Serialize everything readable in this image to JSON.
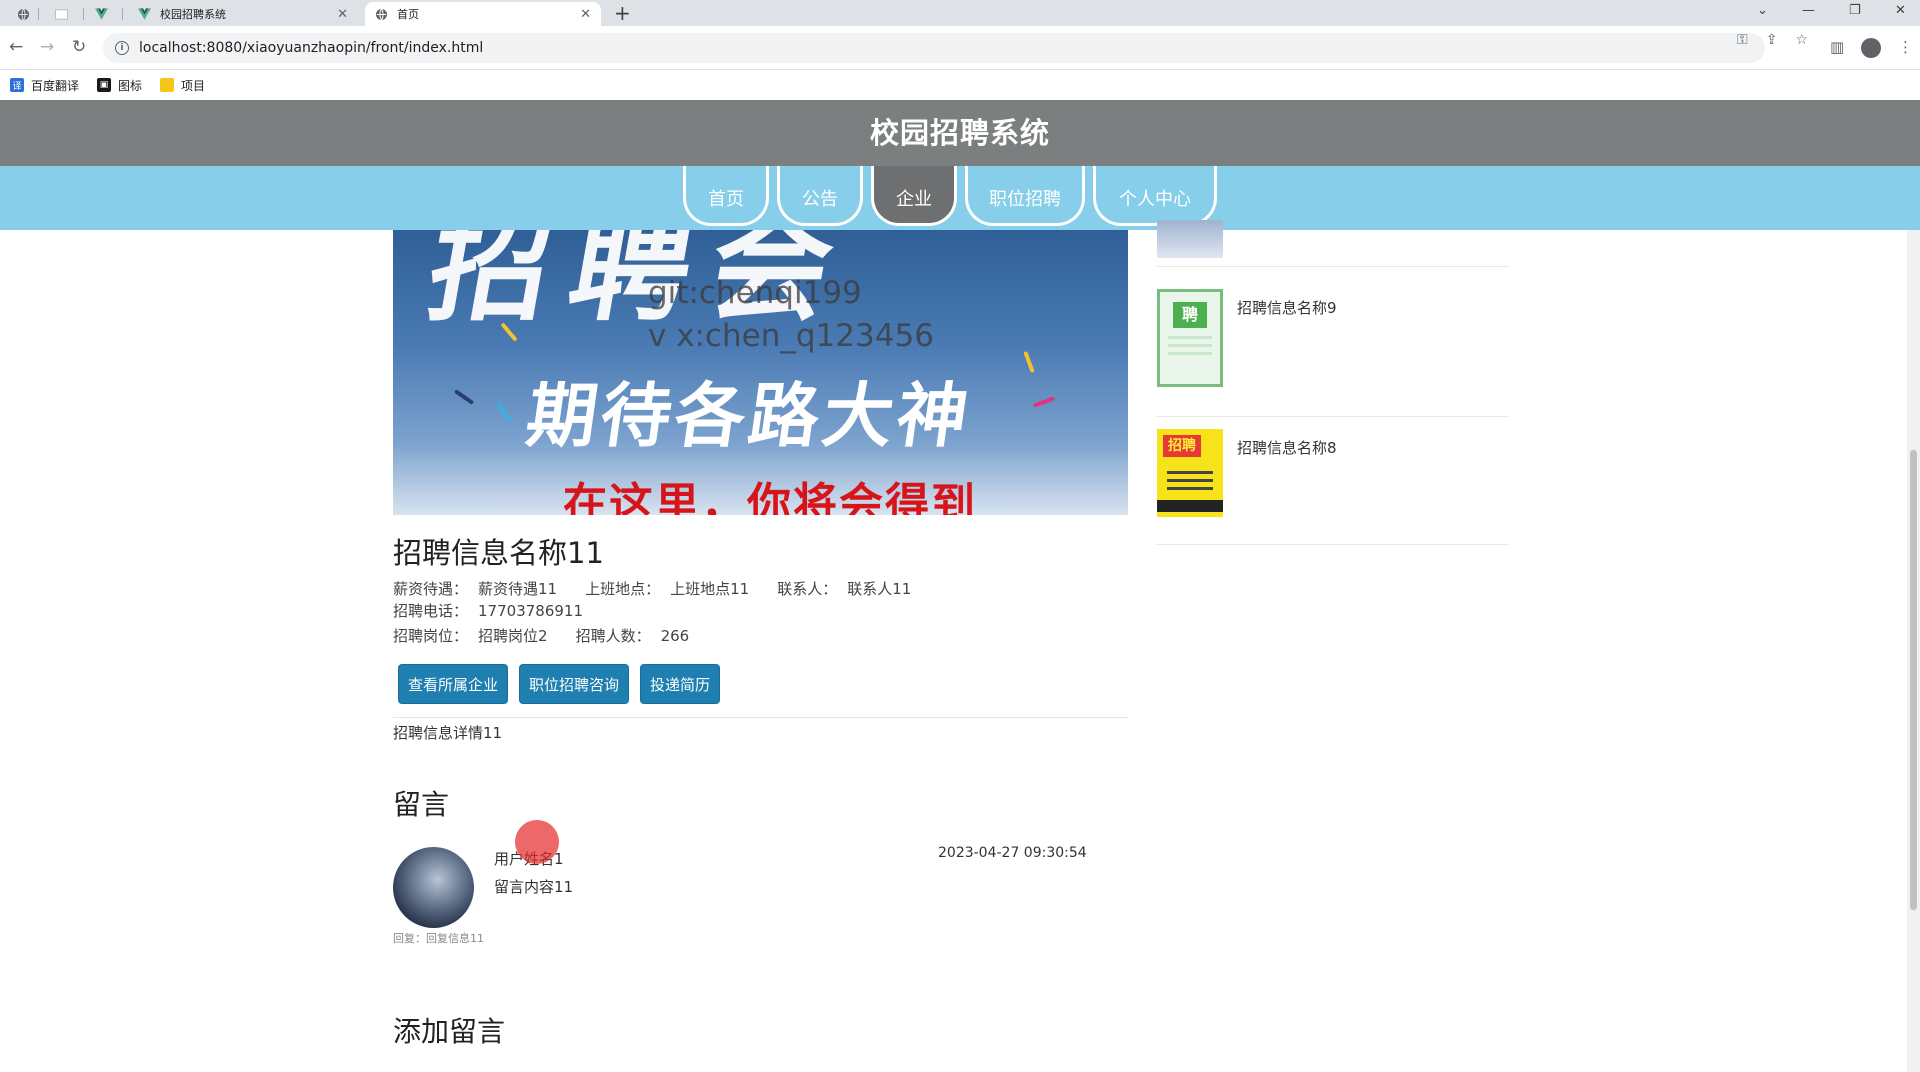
{
  "browser": {
    "tabs": [
      {
        "label": "校园招聘系统"
      },
      {
        "label": "首页"
      }
    ],
    "url": "localhost:8080/xiaoyuanzhaopin/front/index.html",
    "bookmarks": [
      "百度翻译",
      "图标",
      "项目"
    ]
  },
  "site": {
    "title": "校园招聘系统",
    "nav": [
      "首页",
      "公告",
      "企业",
      "职位招聘",
      "个人中心"
    ],
    "active_nav": "企业"
  },
  "banner": {
    "watermark_line1": "git:chenqi199",
    "watermark_line2": "v x:chen_q123456",
    "art_text1": "招聘会",
    "art_text2": "期待各路大神",
    "art_text3": "在这里，你将会得到"
  },
  "job": {
    "title": "招聘信息名称11",
    "salary_label": "薪资待遇：",
    "salary": "薪资待遇11",
    "location_label": "上班地点：",
    "location": "上班地点11",
    "contact_label": "联系人：",
    "contact": "联系人11",
    "phone_label": "招聘电话：",
    "phone": "17703786911",
    "position_label": "招聘岗位：",
    "position": "招聘岗位2",
    "headcount_label": "招聘人数：",
    "headcount": "266",
    "buttons": {
      "company": "查看所属企业",
      "consult": "职位招聘咨询",
      "apply": "投递简历"
    },
    "details": "招聘信息详情11"
  },
  "comments": {
    "heading": "留言",
    "items": [
      {
        "user": "用户姓名1",
        "content": "留言内容11",
        "time": "2023-04-27 09:30:54",
        "reply": "回复：回复信息11"
      }
    ],
    "add_heading": "添加留言"
  },
  "sidebar": {
    "items": [
      {
        "label": ""
      },
      {
        "label": "招聘信息名称9"
      },
      {
        "label": "招聘信息名称8"
      }
    ]
  },
  "colors": {
    "header_bg": "#7b7f80",
    "nav_bg": "#87ceeb",
    "button_bg": "#1f7fb0"
  }
}
